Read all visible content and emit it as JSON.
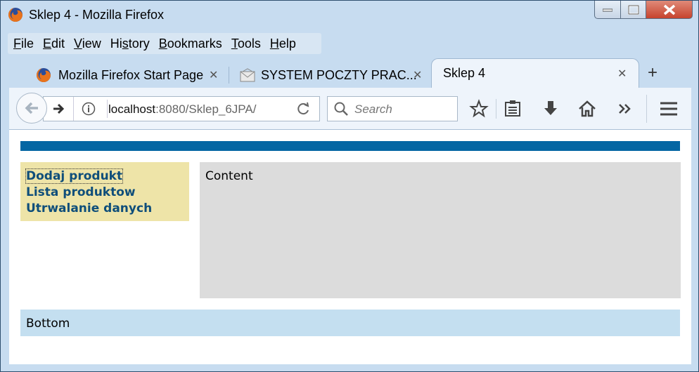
{
  "window": {
    "title": "Sklep 4 - Mozilla Firefox"
  },
  "menubar": [
    {
      "underline": "F",
      "rest": "ile"
    },
    {
      "underline": "E",
      "rest": "dit"
    },
    {
      "underline": "V",
      "rest": "iew"
    },
    {
      "underline": "H",
      "pre": "Hi",
      "mid": "s",
      "rest": "tory"
    },
    {
      "underline": "B",
      "rest": "ookmarks"
    },
    {
      "underline": "T",
      "rest": "ools"
    },
    {
      "underline": "H",
      "rest": "elp"
    }
  ],
  "menu_labels": {
    "file_u": "F",
    "file_rest": "ile",
    "edit_u": "E",
    "edit_rest": "dit",
    "view_u": "V",
    "view_rest": "iew",
    "history_pre": "Hi",
    "history_u": "s",
    "history_rest": "tory",
    "bookmarks_u": "B",
    "bookmarks_rest": "ookmarks",
    "tools_u": "T",
    "tools_rest": "ools",
    "help_u": "H",
    "help_rest": "elp"
  },
  "tabs": [
    {
      "label": "Mozilla Firefox Start Page",
      "icon": "firefox-icon"
    },
    {
      "label": "SYSTEM POCZTY PRAC...",
      "icon": "envelope-icon"
    },
    {
      "label": "Sklep 4",
      "active": true
    }
  ],
  "urlbar": {
    "host": "localhost",
    "path": ":8080/Sklep_6JPA/"
  },
  "search": {
    "placeholder": "Search"
  },
  "page": {
    "menu": [
      "Dodaj produkt",
      "Lista produktow",
      "Utrwalanie danych"
    ],
    "content": "Content",
    "footer": "Bottom"
  },
  "colors": {
    "header_bar": "#0466a3",
    "menu_bg": "#eee4a8",
    "link": "#0f4e7a",
    "content_bg": "#dcdcdc",
    "footer_bg": "#c4dff0"
  }
}
